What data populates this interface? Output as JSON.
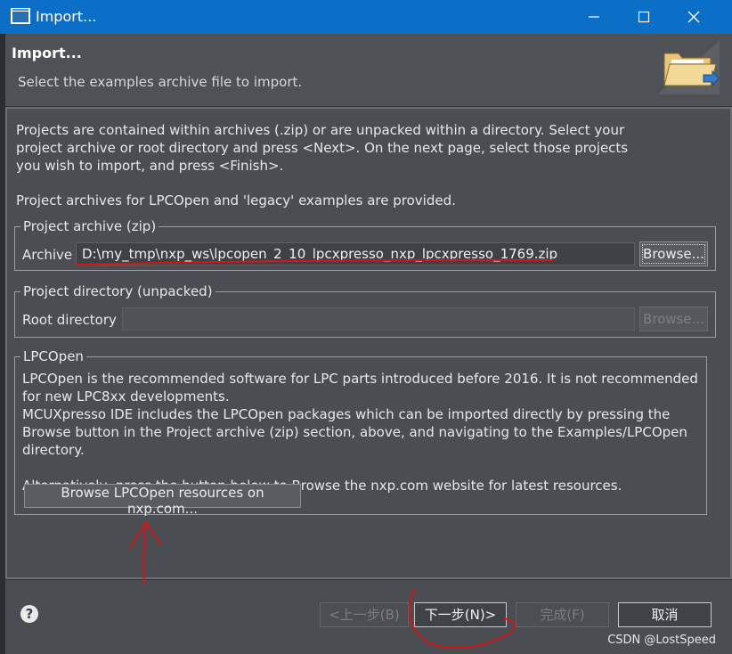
{
  "window": {
    "title": "Import...",
    "header_title": "Import...",
    "header_description": "Select the examples archive file to import."
  },
  "intro": {
    "text": "Projects are contained within archives (.zip) or are unpacked within a directory. Select your project archive or root directory and press <Next>. On the next page, select those projects you wish to import, and press <Finish>.",
    "provided_text": "Project archives for LPCOpen and 'legacy' examples are provided."
  },
  "archive_group": {
    "legend": "Project archive (zip)",
    "label": "Archive",
    "value": "D:\\my_tmp\\nxp_ws\\lpcopen_2_10_lpcxpresso_nxp_lpcxpresso_1769.zip",
    "browse_label": "Browse..."
  },
  "directory_group": {
    "legend": "Project directory (unpacked)",
    "label": "Root directory",
    "value": "",
    "browse_label": "Browse..."
  },
  "lpcopen_group": {
    "legend": "LPCOpen",
    "paragraph1": "LPCOpen is the recommended software for LPC parts introduced before 2016. It is not recommended for new LPC8xx developments.",
    "paragraph2": "MCUXpresso IDE includes the LPCOpen packages which can be imported directly by pressing the Browse button in the Project archive (zip) section, above, and navigating to the Examples/LPCOpen directory.",
    "paragraph3": "Alternatively, press the button below to Browse the nxp.com website for latest resources.",
    "button_label": "Browse LPCOpen resources on nxp.com..."
  },
  "footer": {
    "back_label": "<上一步(B)",
    "next_label": "下一步(N)>",
    "finish_label": "完成(F)",
    "cancel_label": "取消"
  },
  "watermark": "CSDN @LostSpeed",
  "colors": {
    "titlebar": "#0b6fc8",
    "dialog_bg": "#4a4d51",
    "annotation": "#d01818"
  }
}
